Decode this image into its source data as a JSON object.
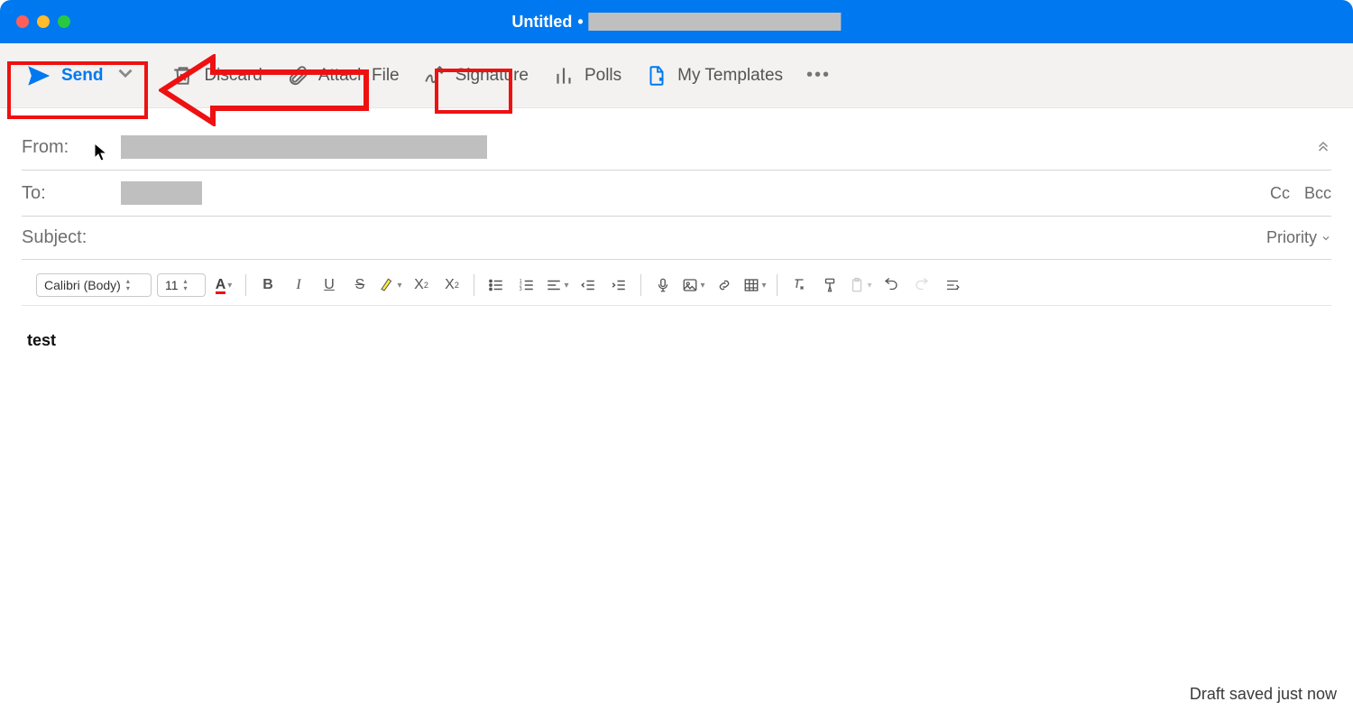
{
  "window": {
    "title": "Untitled",
    "title_sep": "•"
  },
  "toolbar": {
    "send": "Send",
    "discard": "Discard",
    "attach": "Attach File",
    "signature": "Signature",
    "polls": "Polls",
    "templates": "My Templates",
    "more": "•••"
  },
  "fields": {
    "from_label": "From:",
    "to_label": "To:",
    "subject_label": "Subject:",
    "cc": "Cc",
    "bcc": "Bcc",
    "priority": "Priority"
  },
  "format": {
    "font": "Calibri (Body)",
    "size": "11"
  },
  "body": {
    "text": "test"
  },
  "status": {
    "text": "Draft saved just now"
  },
  "colors": {
    "accent": "#0078f0",
    "annotation": "#e11"
  }
}
